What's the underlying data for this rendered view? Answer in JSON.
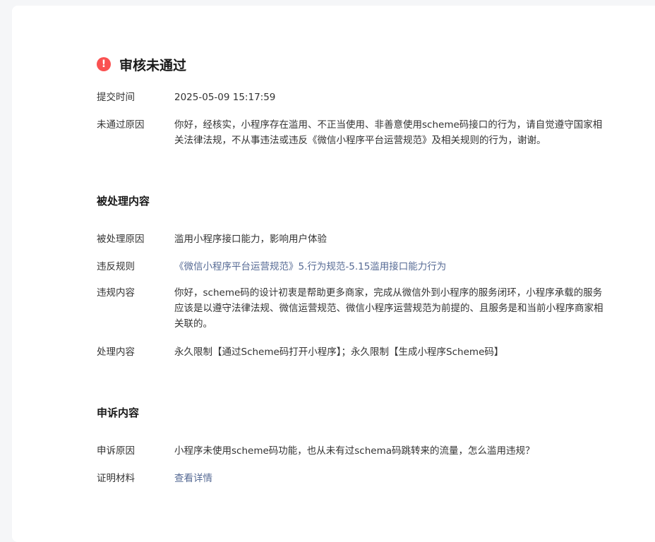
{
  "status": {
    "icon": "alert-circle-icon",
    "mark": "!",
    "title": "审核未通过",
    "color": "#fa5151"
  },
  "review": {
    "submit_time_label": "提交时间",
    "submit_time_value": "2025-05-09 15:17:59",
    "reason_label": "未通过原因",
    "reason_value": "你好，经核实，小程序存在滥用、不正当使用、非善意使用scheme码接口的行为，请自觉遵守国家相关法律法规，不从事违法或违反《微信小程序平台运营规范》及相关规则的行为，谢谢。"
  },
  "processed": {
    "section_title": "被处理内容",
    "reason_label": "被处理原因",
    "reason_value": "滥用小程序接口能力，影响用户体验",
    "rule_label": "违反规则",
    "rule_value": "《微信小程序平台运营规范》5.行为规范-5.15滥用接口能力行为",
    "content_label": "违规内容",
    "content_value": "你好，scheme码的设计初衷是帮助更多商家，完成从微信外到小程序的服务闭环，小程序承载的服务应该是以遵守法律法规、微信运营规范、微信小程序运营规范为前提的、且服务是和当前小程序商家相关联的。",
    "action_label": "处理内容",
    "action_value": "永久限制【通过Scheme码打开小程序】；永久限制【生成小程序Scheme码】"
  },
  "appeal": {
    "section_title": "申诉内容",
    "reason_label": "申诉原因",
    "reason_value": "小程序未使用scheme码功能，也从未有过schema码跳转来的流量，怎么滥用违规？",
    "evidence_label": "证明材料",
    "evidence_link": "查看详情"
  },
  "colors": {
    "link": "#576b95",
    "error": "#fa5151"
  }
}
